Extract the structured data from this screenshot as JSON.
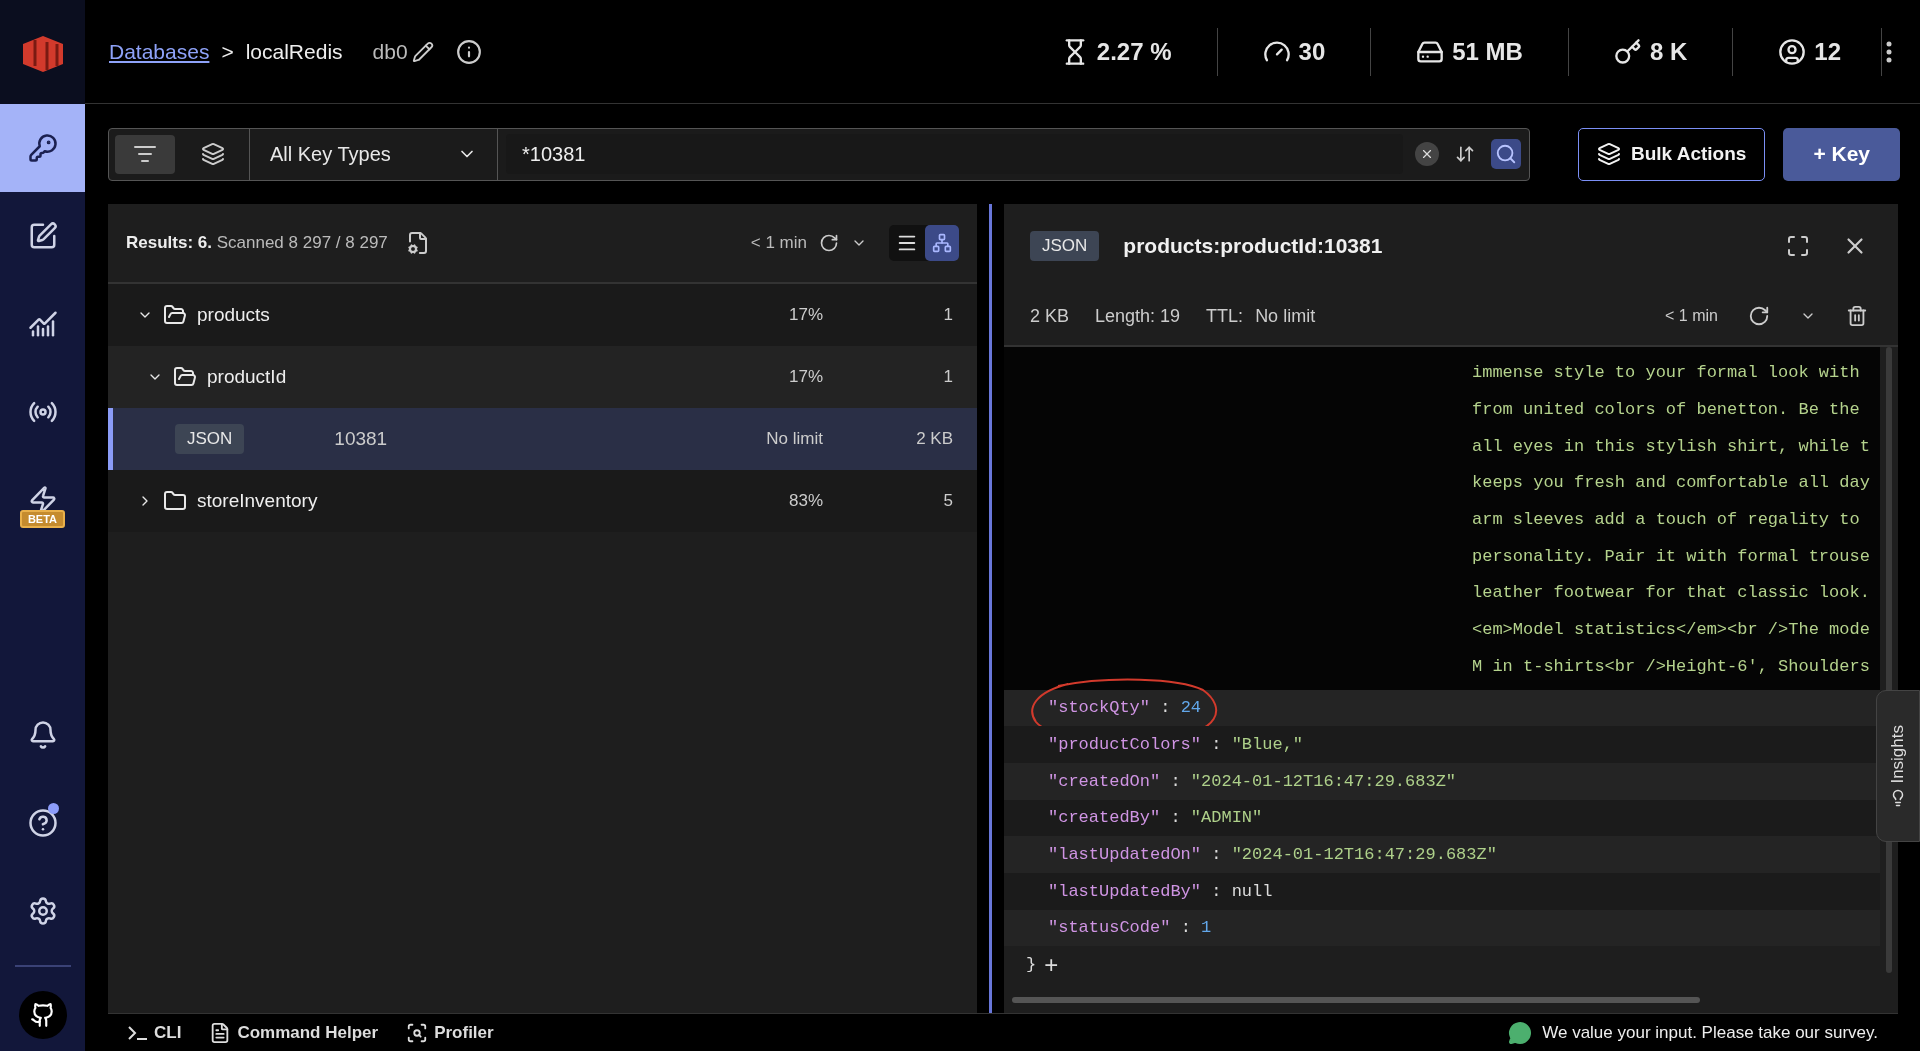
{
  "sidebar": {
    "items": [
      {
        "selected": true
      },
      {
        "selected": false
      },
      {
        "selected": false
      },
      {
        "selected": false
      },
      {
        "selected": false,
        "badge": "BETA"
      }
    ],
    "bottom_items": [
      {
        "notification": false
      },
      {
        "notification": true
      },
      {
        "notification": false
      }
    ]
  },
  "top_bar": {
    "breadcrumb_link": "Databases",
    "breadcrumb_separator": ">",
    "database": "localRedis",
    "db_index": "db0",
    "stats": [
      "2.27 %",
      "30",
      "51 MB",
      "8 K",
      "12"
    ]
  },
  "filter": {
    "modes": [
      {
        "selected": true
      },
      {
        "selected": false
      }
    ],
    "key_type": "All Key Types",
    "pattern": "*10381"
  },
  "buttons": [
    "Bulk Actions",
    "+ Key"
  ],
  "results": {
    "summary": "**Results: 6.** Scanned 8 297 / 8 297",
    "refreshed": "< 1 min",
    "views": [
      {
        "selected": false
      },
      {
        "selected": true
      }
    ]
  },
  "tree": [
    {
      "kind": "folder",
      "name": "products",
      "expanded": true,
      "percent": "17%",
      "count": "1",
      "children": [
        {
          "kind": "folder",
          "name": "productId",
          "expanded": true,
          "percent": "17%",
          "count": "1",
          "children": [
            {
              "kind": "key",
              "type": "JSON",
              "name": "10381",
              "ttl": "No limit",
              "size": "2 KB",
              "selected": true
            }
          ]
        }
      ]
    },
    {
      "kind": "folder",
      "name": "storeInventory",
      "expanded": false,
      "percent": "83%",
      "count": "5"
    }
  ],
  "details": {
    "type": "JSON",
    "key": "products:productId:10381",
    "size": "2 KB",
    "length": "Length: 19",
    "ttl_label": "TTL:",
    "ttl": "No limit",
    "refreshed": "< 1 min",
    "description_lines": [
      "immense style to your formal look with",
      "from united colors of benetton. Be the",
      "all eyes in this stylish shirt, while t",
      "keeps you fresh and comfortable all day",
      "arm sleeves add a touch of regality to",
      "personality. Pair it with formal trouse",
      "leather footwear for that classic look.",
      "<em>Model statistics</em><br />The mode",
      "M in t-shirts<br />Height-6', Shoulders"
    ],
    "fields": [
      {
        "key": "\"stockQty\"",
        "separator": ":",
        "value": "24",
        "kind": "number",
        "circled": true
      },
      {
        "key": "\"productColors\"",
        "separator": ":",
        "value": "\"Blue,\"",
        "kind": "string",
        "circled": false
      },
      {
        "key": "\"createdOn\"",
        "separator": ":",
        "value": "\"2024-01-12T16:47:29.683Z\"",
        "kind": "string",
        "circled": false
      },
      {
        "key": "\"createdBy\"",
        "separator": ":",
        "value": "\"ADMIN\"",
        "kind": "string",
        "circled": false
      },
      {
        "key": "\"lastUpdatedOn\"",
        "separator": ":",
        "value": "\"2024-01-12T16:47:29.683Z\"",
        "kind": "string",
        "circled": false
      },
      {
        "key": "\"lastUpdatedBy\"",
        "separator": ":",
        "value": "null",
        "kind": "null",
        "circled": false
      },
      {
        "key": "\"statusCode\"",
        "separator": ":",
        "value": "1",
        "kind": "number",
        "circled": false
      }
    ],
    "closing": "}",
    "add": "+"
  },
  "insights": "Insights",
  "footer": {
    "tools": [
      "CLI",
      "Command Helper",
      "Profiler"
    ],
    "survey": "We value your input. Please take our survey."
  }
}
